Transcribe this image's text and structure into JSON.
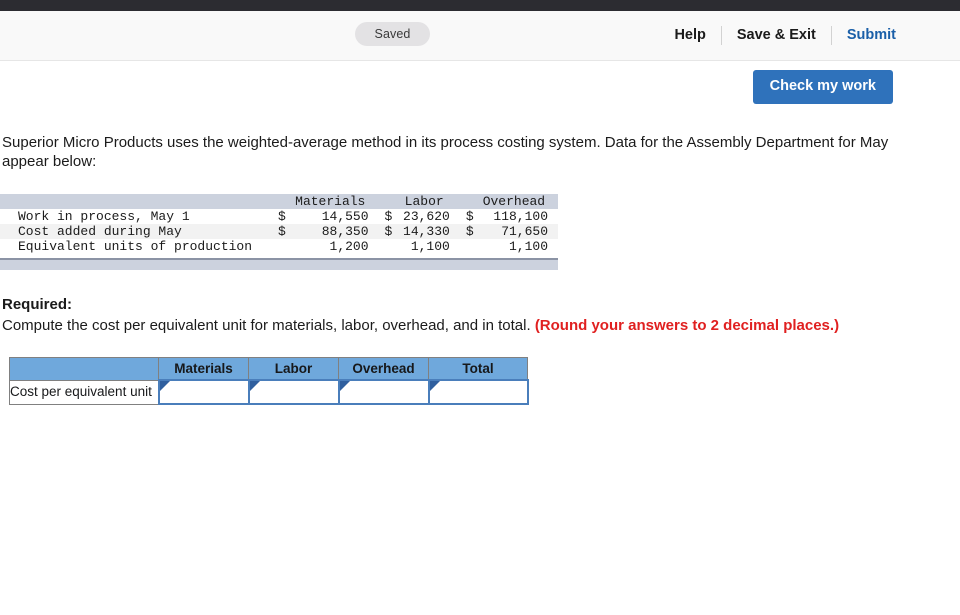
{
  "header": {
    "status_badge": "Saved",
    "actions": [
      {
        "label": "Help",
        "style": "dark"
      },
      {
        "label": "Save & Exit",
        "style": "dark"
      },
      {
        "label": "Submit",
        "style": "blue"
      }
    ]
  },
  "toolbar": {
    "check_my_work_label": "Check my work"
  },
  "question": {
    "intro": "Superior Micro Products uses the weighted-average method in its process costing system. Data for the Assembly Department for May appear below:",
    "required_label": "Required:",
    "required_text": "Compute the cost per equivalent unit for materials, labor, overhead, and in total.",
    "rounding_note": "(Round your answers to 2 decimal places.)"
  },
  "data_table": {
    "columns": [
      "Materials",
      "Labor",
      "Overhead"
    ],
    "rows": [
      {
        "label": "Work in process, May 1",
        "cells": [
          {
            "currency": "$",
            "value": "14,550"
          },
          {
            "currency": "$",
            "value": "23,620"
          },
          {
            "currency": "$",
            "value": "118,100"
          }
        ]
      },
      {
        "label": "Cost added during May",
        "cells": [
          {
            "currency": "$",
            "value": "88,350"
          },
          {
            "currency": "$",
            "value": "14,330"
          },
          {
            "currency": "$",
            "value": "71,650"
          }
        ]
      },
      {
        "label": "Equivalent units of production",
        "cells": [
          {
            "currency": "",
            "value": "1,200"
          },
          {
            "currency": "",
            "value": "1,100"
          },
          {
            "currency": "",
            "value": "1,100"
          }
        ]
      }
    ]
  },
  "answer_table": {
    "corner_header": "",
    "columns": [
      "Materials",
      "Labor",
      "Overhead",
      "Total"
    ],
    "row_label": "Cost per equivalent unit",
    "values": [
      "",
      "",
      "",
      ""
    ]
  },
  "colors": {
    "topbar": "#2c2c31",
    "header_bg": "#f9f9f9",
    "badge_bg": "#e3e2e4",
    "accent_blue": "#2f72bb",
    "link_blue": "#1a5fa8",
    "table_head_blue": "#6fa8dc",
    "data_head_gray": "#ccd2de",
    "red_note": "#e02020"
  }
}
